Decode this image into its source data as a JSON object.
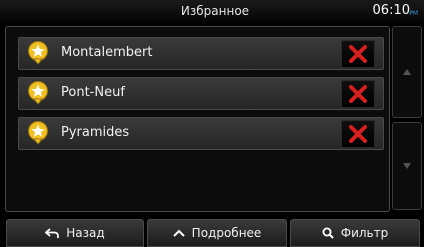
{
  "status": {
    "title": "Избранное",
    "time": "06:10",
    "time_suffix": "PM"
  },
  "favorites": [
    {
      "name": "Montalembert"
    },
    {
      "name": "Pont-Neuf"
    },
    {
      "name": "Pyramides"
    }
  ],
  "icons": {
    "favorite": "star-pin-icon",
    "delete": "red-x-icon",
    "scroll_up": "arrow-up-icon",
    "scroll_down": "arrow-down-icon",
    "back": "back-arrow-icon",
    "more": "chevron-up-icon",
    "filter": "search-icon"
  },
  "colors": {
    "delete": "#d81e1e",
    "accent": "#3d9be0",
    "star": "#f0c020"
  },
  "bottom": {
    "back_label": "Назад",
    "more_label": "Подробнее",
    "filter_label": "Фильтр"
  }
}
